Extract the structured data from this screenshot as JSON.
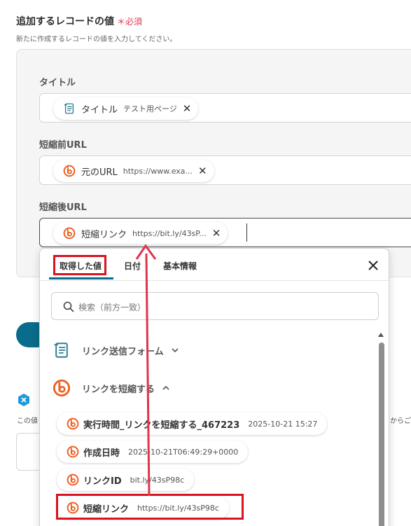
{
  "section": {
    "title": "追加するレコードの値",
    "required": "＊必須",
    "description": "新たに作成するレコードの値を入力してください。"
  },
  "fields": [
    {
      "label": "タイトル",
      "chip": {
        "name": "タイトル",
        "value": "テスト用ページ",
        "icon": "page-icon"
      }
    },
    {
      "label": "短縮前URL",
      "chip": {
        "name": "元のURL",
        "value": "https://www.exa...",
        "icon": "bitly-icon"
      }
    },
    {
      "label": "短縮後URL",
      "chip": {
        "name": "短縮リンク",
        "value": "https://bit.ly/43sP...",
        "icon": "bitly-icon"
      }
    }
  ],
  "background": {
    "fragment_left": "この値",
    "fragment_right": "からご"
  },
  "dropdown": {
    "tabs": [
      "取得した値",
      "日付",
      "基本情報"
    ],
    "active_tab": "取得した値",
    "search_placeholder": "検索（前方一致）",
    "groups": [
      {
        "label": "リンク送信フォーム",
        "expanded": false,
        "icon": "form-icon"
      },
      {
        "label": "リンクを短縮する",
        "expanded": true,
        "icon": "bitly-icon"
      }
    ],
    "items": [
      {
        "name": "実行時間_リンクを短縮する_467223",
        "value": "2025-10-21 15:27"
      },
      {
        "name": "作成日時",
        "value": "2025-10-21T06:49:29+0000"
      },
      {
        "name": "リンクID",
        "value": "bit.ly/43sP98c"
      },
      {
        "name": "短縮リンク",
        "value": "https://bit.ly/43sP98c"
      }
    ]
  },
  "colors": {
    "accent": "#0a6c8b",
    "bitly": "#ee6123",
    "required": "#e0344a",
    "annotation": "#d9131f"
  }
}
